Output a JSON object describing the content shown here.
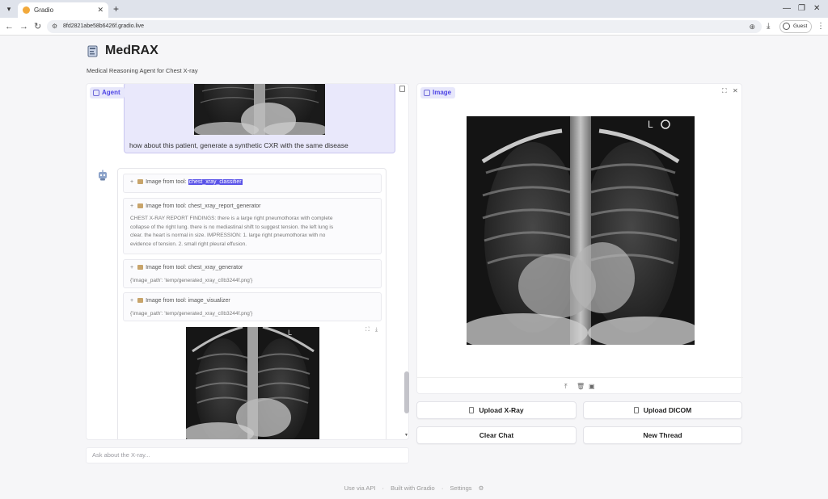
{
  "browser": {
    "tab_title": "Gradio",
    "url": "8fd2821abe58b6426f.gradio.live",
    "profile_label": "Guest"
  },
  "app": {
    "title": "MedRAX",
    "subtitle": "Medical Reasoning Agent for Chest X-ray"
  },
  "agent_panel": {
    "label": "Agent",
    "user_message": "how about this patient, generate a synthetic CXR with the same disease",
    "tool_results": [
      {
        "prefix": "Image from tool: ",
        "tool": "chest_xray_classifier",
        "body": []
      },
      {
        "prefix": "Image from tool: ",
        "tool": "chest_xray_report_generator",
        "body": [
          "CHEST X-RAY REPORT FINDINGS: there is a large right pneumothorax with complete",
          "collapse of the right lung. there is no mediastinal shift to suggest tension. the left lung is",
          "clear. the heart is normal in size. IMPRESSION: 1. large right pneumothorax with no",
          "evidence of tension. 2. small right pleural effusion."
        ]
      },
      {
        "prefix": "Image from tool: ",
        "tool": "chest_xray_generator",
        "body": [
          "{'image_path': 'temp/generated_xray_c0b3244f.png'}"
        ]
      },
      {
        "prefix": "Image from tool: ",
        "tool": "image_visualizer",
        "body": [
          "{'image_path': 'temp/generated_xray_c0b3244f.png'}"
        ]
      }
    ]
  },
  "chat_input": {
    "placeholder": "Ask about the X-ray..."
  },
  "image_panel": {
    "label": "Image"
  },
  "buttons": {
    "upload_xray": "Upload X-Ray",
    "upload_dicom": "Upload DICOM",
    "clear_chat": "Clear Chat",
    "new_thread": "New Thread"
  },
  "footer": {
    "api": "Use via API",
    "built": "Built with Gradio",
    "settings": "Settings",
    "sep": "·"
  },
  "colors": {
    "accent": "#4f46e5",
    "label_bg": "#e7e7fb",
    "user_bubble": "#e9e8fb"
  }
}
